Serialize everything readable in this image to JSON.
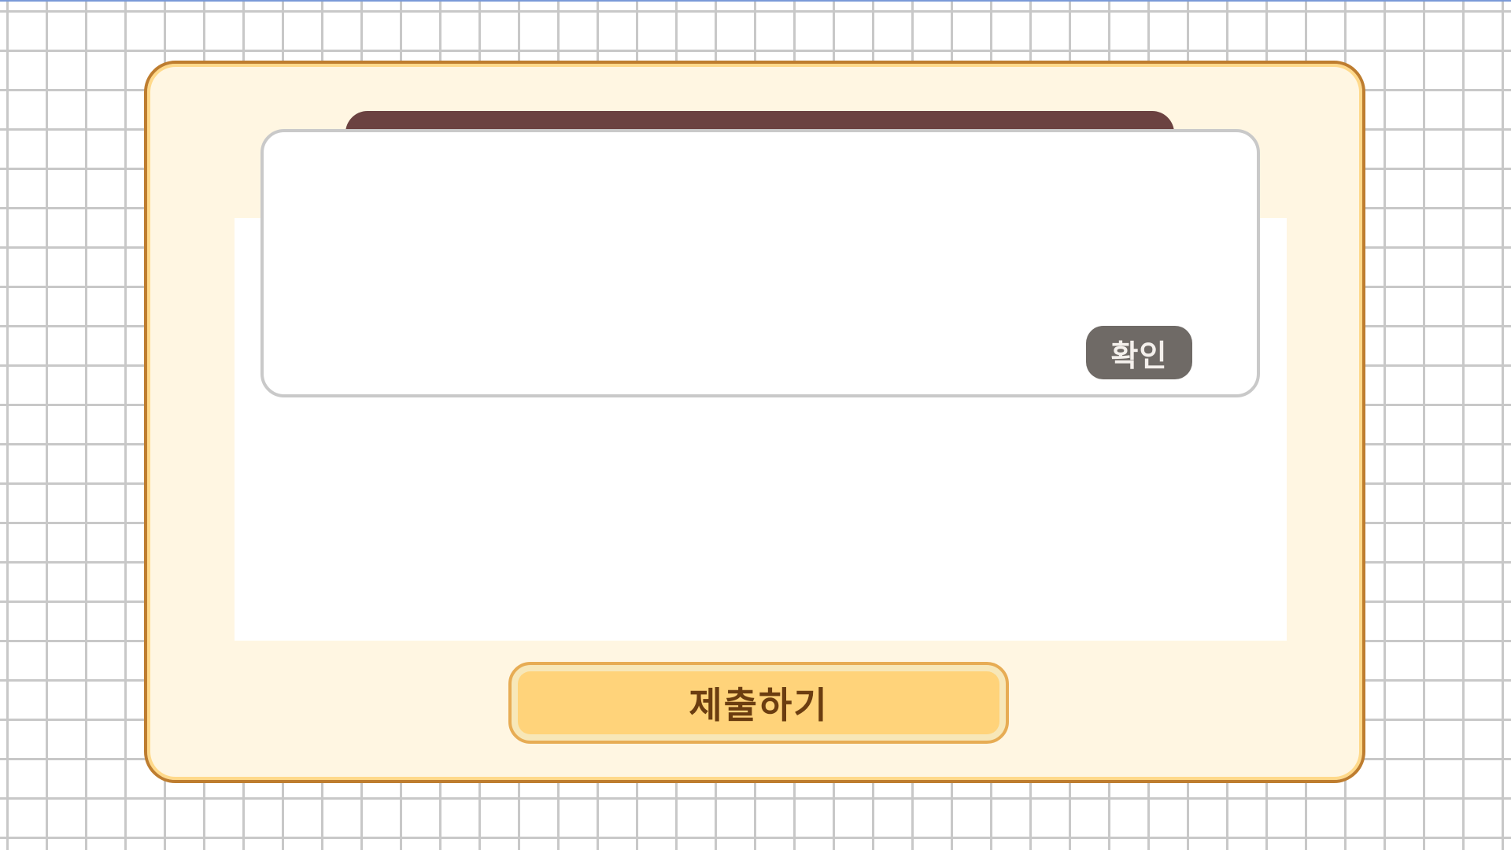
{
  "dialog": {
    "confirm_label": "확인"
  },
  "footer": {
    "submit_label": "제출하기"
  },
  "colors": {
    "card_background": "#fff6e2",
    "card_border": "#be7d2f",
    "title_bar": "#6b4241",
    "confirm_button": "#6f6a66",
    "submit_button": "#ffd37a",
    "submit_text": "#6b3d10",
    "grid_lines": "#c8c8c8"
  }
}
